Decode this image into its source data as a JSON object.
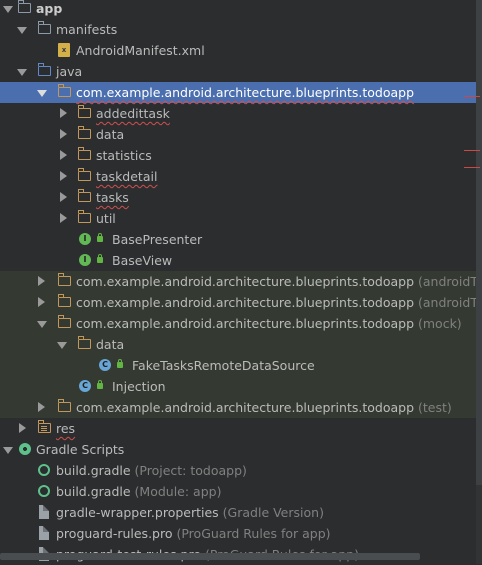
{
  "tree": {
    "app": "app",
    "manifests": "manifests",
    "android_manifest": "AndroidManifest.xml",
    "java": "java",
    "main_pkg": "com.example.android.architecture.blueprints.todoapp",
    "main_children": {
      "addedittask": "addedittask",
      "data": "data",
      "statistics": "statistics",
      "taskdetail": "taskdetail",
      "tasks": "tasks",
      "util": "util",
      "base_presenter": "BasePresenter",
      "base_view": "BaseView"
    },
    "pkg_android_test": {
      "name": "com.example.android.architecture.blueprints.todoapp",
      "suffix": "(androidTest)"
    },
    "pkg_android_test_mock": {
      "name": "com.example.android.architecture.blueprints.todoapp",
      "suffix": "(androidTestM"
    },
    "pkg_mock": {
      "name": "com.example.android.architecture.blueprints.todoapp",
      "suffix": "(mock)"
    },
    "mock_children": {
      "data": "data",
      "fake_source": "FakeTasksRemoteDataSource",
      "injection": "Injection"
    },
    "pkg_test": {
      "name": "com.example.android.architecture.blueprints.todoapp",
      "suffix": "(test)"
    },
    "res": "res",
    "gradle_scripts": "Gradle Scripts",
    "build_gradle_project": {
      "name": "build.gradle",
      "suffix": "(Project: todoapp)"
    },
    "build_gradle_module": {
      "name": "build.gradle",
      "suffix": "(Module: app)"
    },
    "gradle_wrapper": {
      "name": "gradle-wrapper.properties",
      "suffix": "(Gradle Version)"
    },
    "proguard_rules": {
      "name": "proguard-rules.pro",
      "suffix": "(ProGuard Rules for app)"
    },
    "proguard_test_rules": {
      "name": "proguard-test-rules.pro",
      "suffix": "(ProGuard Rules for app)"
    }
  },
  "icons": {
    "interface_badge": "I",
    "class_badge": "C",
    "xml_badge": "x"
  },
  "colors": {
    "background": "#2b2d2f",
    "selection": "#4b6eaf",
    "package_folder": "#c2985a",
    "source_folder": "#5f8ac6",
    "interface": "#63b856",
    "class": "#67a6d6",
    "error_underline": "#d05050"
  }
}
